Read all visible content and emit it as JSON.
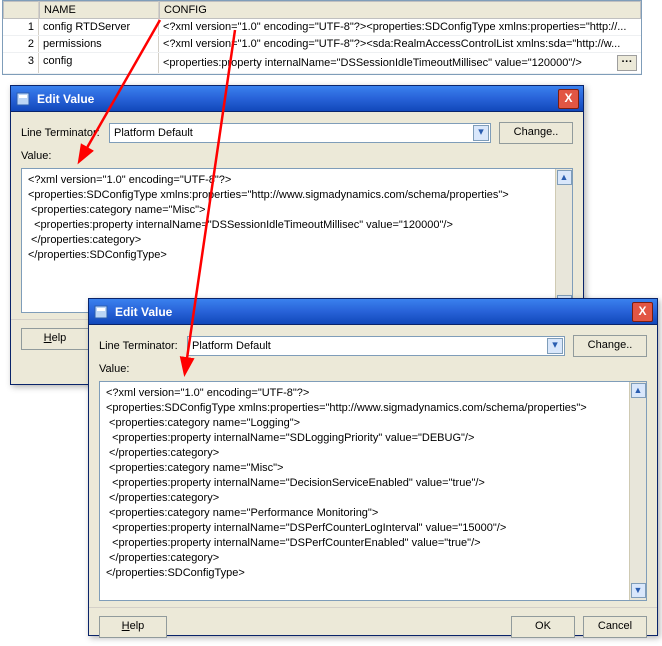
{
  "table": {
    "headers": {
      "name": "NAME",
      "config": "CONFIG"
    },
    "rows": [
      {
        "idx": "1",
        "name": "config RTDServer",
        "config": "<?xml version=\"1.0\" encoding=\"UTF-8\"?><properties:SDConfigType xmlns:properties=\"http://..."
      },
      {
        "idx": "2",
        "name": "permissions",
        "config": "<?xml version=\"1.0\" encoding=\"UTF-8\"?><sda:RealmAccessControlList xmlns:sda=\"http://w..."
      },
      {
        "idx": "3",
        "name": "config",
        "config": "<properties:property internalName=\"DSSessionIdleTimeoutMillisec\" value=\"120000\"/>"
      }
    ]
  },
  "dialog1": {
    "title": "Edit Value",
    "line_terminator_label": "Line Terminator:",
    "line_terminator_value": "Platform Default",
    "change_label": "Change..",
    "value_label": "Value:",
    "help_label": "Help",
    "xml_lines": [
      "<?xml version=\"1.0\" encoding=\"UTF-8\"?>",
      "<properties:SDConfigType xmlns:properties=\"http://www.sigmadynamics.com/schema/properties\">",
      " <properties:category name=\"Misc\">",
      "  <properties:property internalName=\"DSSessionIdleTimeoutMillisec\" value=\"120000\"/>",
      " </properties:category>",
      "</properties:SDConfigType>"
    ]
  },
  "dialog2": {
    "title": "Edit Value",
    "line_terminator_label": "Line Terminator:",
    "line_terminator_value": "Platform Default",
    "change_label": "Change..",
    "value_label": "Value:",
    "help_label": "Help",
    "ok_label": "OK",
    "cancel_label": "Cancel",
    "xml_lines": [
      "<?xml version=\"1.0\" encoding=\"UTF-8\"?>",
      "<properties:SDConfigType xmlns:properties=\"http://www.sigmadynamics.com/schema/properties\">",
      " <properties:category name=\"Logging\">",
      "  <properties:property internalName=\"SDLoggingPriority\" value=\"DEBUG\"/>",
      " </properties:category>",
      " <properties:category name=\"Misc\">",
      "  <properties:property internalName=\"DecisionServiceEnabled\" value=\"true\"/>",
      " </properties:category>",
      " <properties:category name=\"Performance Monitoring\">",
      "  <properties:property internalName=\"DSPerfCounterLogInterval\" value=\"15000\"/>",
      "  <properties:property internalName=\"DSPerfCounterEnabled\" value=\"true\"/>",
      " </properties:category>",
      "</properties:SDConfigType>"
    ]
  },
  "icons": {
    "close": "X"
  }
}
